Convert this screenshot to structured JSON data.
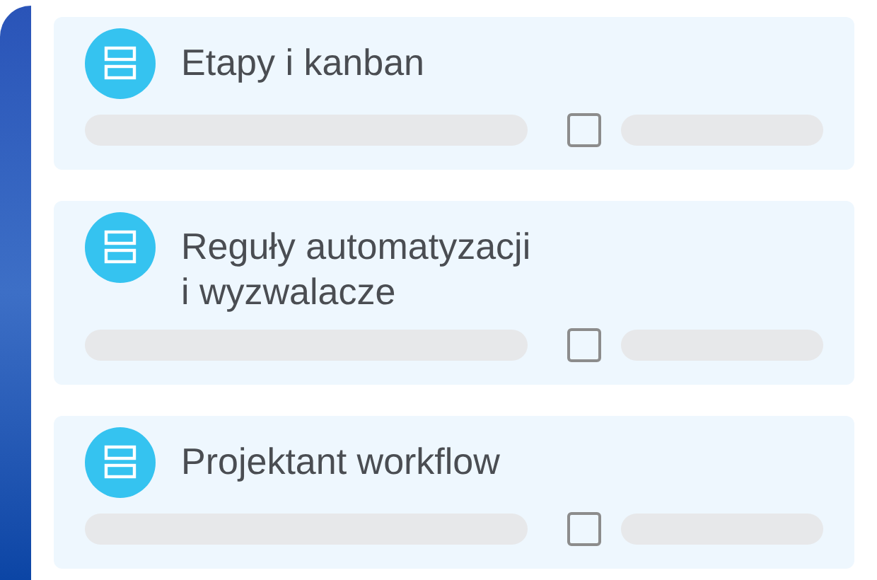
{
  "cards": [
    {
      "title": "Etapy i kanban",
      "checked": false
    },
    {
      "title": "Reguły automatyzacji\ni wyzwalacze",
      "checked": false
    },
    {
      "title": "Projektant workflow",
      "checked": false
    }
  ]
}
